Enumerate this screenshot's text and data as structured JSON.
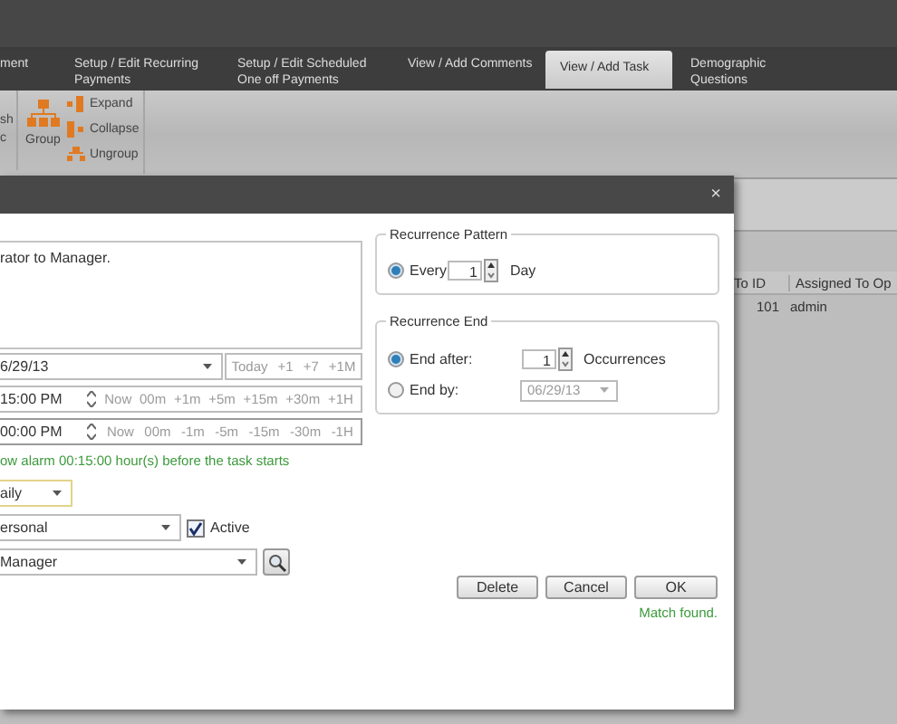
{
  "tabs": [
    {
      "label": "ment",
      "selected": false
    },
    {
      "label": "Setup / Edit Recurring Payments",
      "selected": false
    },
    {
      "label": "Setup / Edit Scheduled One off Payments",
      "selected": false
    },
    {
      "label": "View / Add Comments",
      "selected": false
    },
    {
      "label": "View / Add Task",
      "selected": true
    },
    {
      "label": "Demographic Questions",
      "selected": false
    }
  ],
  "ribbon": {
    "partial_labels": [
      "sh",
      "c"
    ],
    "group_button": "Group",
    "items": [
      {
        "kind": "expand",
        "label": "Expand"
      },
      {
        "kind": "collapse",
        "label": "Collapse"
      },
      {
        "kind": "ungroup",
        "label": "Ungroup"
      }
    ]
  },
  "grid": {
    "columns": [
      "To ID",
      "Assigned To Op"
    ],
    "rows": [
      [
        "101",
        "admin"
      ]
    ]
  },
  "dialog": {
    "close": "×",
    "description": "rator to Manager.",
    "date": "6/29/13",
    "date_shortcuts": [
      "Today",
      "+1",
      "+7",
      "+1M"
    ],
    "times": [
      {
        "value": "15:00 PM",
        "shortcuts": [
          "Now",
          "00m",
          "+1m",
          "+5m",
          "+15m",
          "+30m",
          "+1H"
        ]
      },
      {
        "value": "00:00 PM",
        "shortcuts": [
          "Now",
          "00m",
          "-1m",
          "-5m",
          "-15m",
          "-30m",
          "-1H"
        ]
      }
    ],
    "alarm_text": "ow alarm 00:15:00 hour(s) before the task starts",
    "frequency": "aily",
    "category": "ersonal",
    "active": {
      "label": "Active",
      "checked": true
    },
    "assignee": "Manager",
    "recurrence_pattern": {
      "title": "Recurrence Pattern",
      "label": "Every",
      "selected": true,
      "value": "1",
      "unit": "Day"
    },
    "recurrence_end": {
      "title": "Recurrence End",
      "options": [
        {
          "kind": "count",
          "label": "End after:",
          "selected": true,
          "value": "1",
          "unit": "Occurrences"
        },
        {
          "kind": "date",
          "label": "End by:",
          "selected": false,
          "value": "06/29/13"
        }
      ]
    },
    "buttons": [
      "Delete",
      "Cancel",
      "OK"
    ],
    "status": "Match found."
  }
}
